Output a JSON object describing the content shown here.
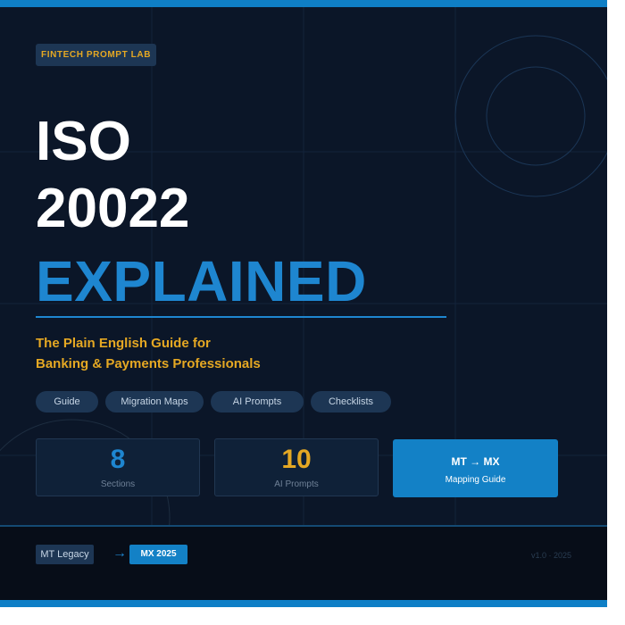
{
  "brand": {
    "badge_label": "FINTECH PROMPT LAB"
  },
  "title": {
    "line1": "ISO",
    "line2": "20022",
    "line3": "EXPLAINED"
  },
  "subtitle": {
    "line1": "The Plain English Guide for",
    "line2": "Banking & Payments Professionals"
  },
  "tags": [
    "Guide",
    "Migration Maps",
    "AI Prompts",
    "Checklists"
  ],
  "stats": [
    {
      "value": "8",
      "label": "Sections",
      "color": "#1e86d0"
    },
    {
      "value": "10",
      "label": "AI Prompts",
      "color": "#e5a823"
    }
  ],
  "mapping_card": {
    "title": "MT → MX",
    "subtitle": "Mapping Guide"
  },
  "footer": {
    "legacy_label": "MT Legacy",
    "arrow": "→",
    "target_label": "MX 2025",
    "version": "v1.0 · 2025"
  },
  "colors": {
    "background": "#0b1628",
    "accent_blue": "#0f7fc6",
    "accent_gold": "#e5a823"
  }
}
